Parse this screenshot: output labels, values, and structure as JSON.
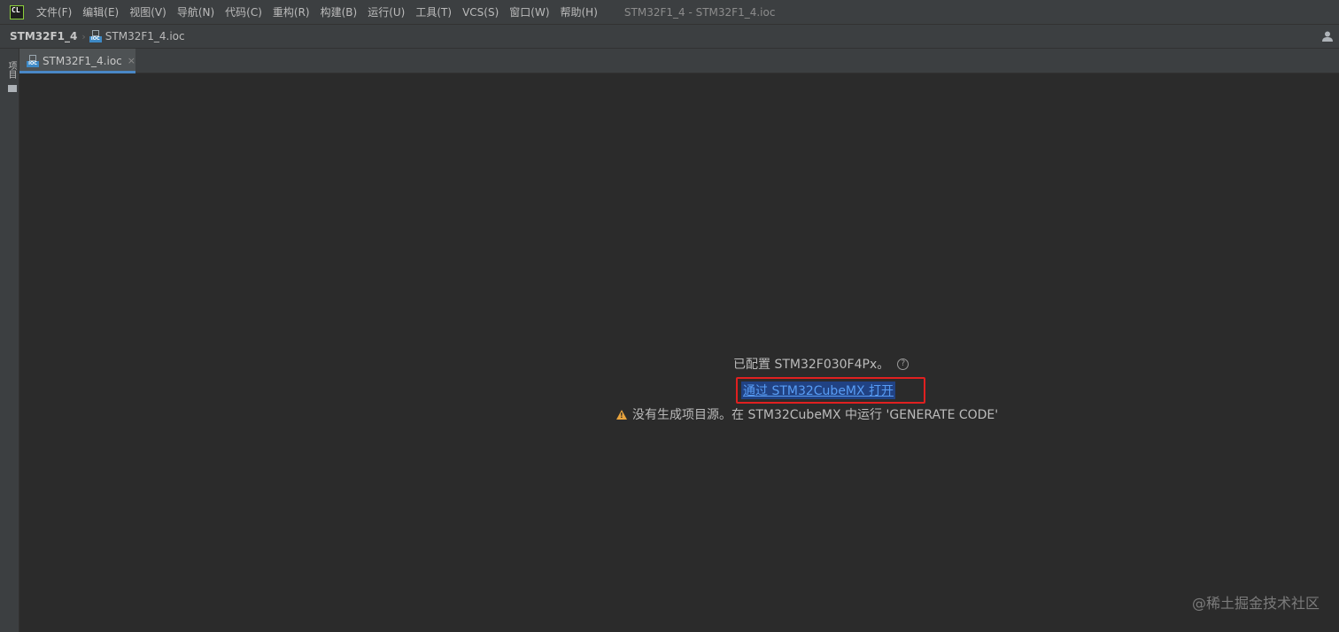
{
  "menubar": {
    "logo_text": "CL",
    "items": [
      "文件(F)",
      "编辑(E)",
      "视图(V)",
      "导航(N)",
      "代码(C)",
      "重构(R)",
      "构建(B)",
      "运行(U)",
      "工具(T)",
      "VCS(S)",
      "窗口(W)",
      "帮助(H)"
    ],
    "window_title": "STM32F1_4 - STM32F1_4.ioc"
  },
  "navbar": {
    "project": "STM32F1_4",
    "file": "STM32F1_4.ioc"
  },
  "stripe": {
    "project_label": "项目"
  },
  "tabs": [
    {
      "label": "STM32F1_4.ioc",
      "close": "×",
      "active": true
    }
  ],
  "editor": {
    "configured_text": "已配置 STM32F030F4Px。",
    "help_glyph": "?",
    "open_link": "通过 STM32CubeMX 打开",
    "warning_glyph": "!",
    "warning_text": "没有生成项目源。在 STM32CubeMX 中运行 'GENERATE CODE'"
  },
  "watermark": "@稀土掘金技术社区",
  "colors": {
    "link": "#589df6",
    "highlight_box": "#e02020",
    "warning": "#e8a33d",
    "tab_accent": "#4a88c7"
  }
}
